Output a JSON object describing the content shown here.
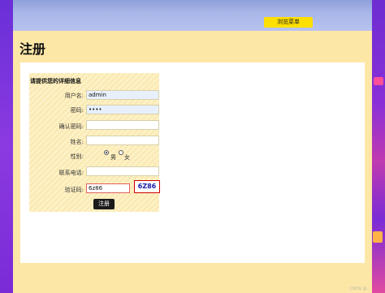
{
  "header": {
    "menu_label": "浏览菜单"
  },
  "page": {
    "title": "注册"
  },
  "form": {
    "heading": "请提供您的详细信息",
    "fields": {
      "username": {
        "label": "用户名:",
        "value": "admin"
      },
      "password": {
        "label": "密码:",
        "value": "••••"
      },
      "confirm_password": {
        "label": "确认密码:",
        "value": ""
      },
      "name": {
        "label": "姓名:",
        "value": ""
      },
      "gender": {
        "label": "性别:",
        "options": [
          "男",
          "女"
        ],
        "selected": "男"
      },
      "phone": {
        "label": "联系电话:",
        "value": ""
      },
      "captcha": {
        "label": "验证码:",
        "value": "6z86",
        "image_text": "6Z86"
      }
    },
    "submit_label": "注册"
  },
  "watermark": "CSDN @..."
}
